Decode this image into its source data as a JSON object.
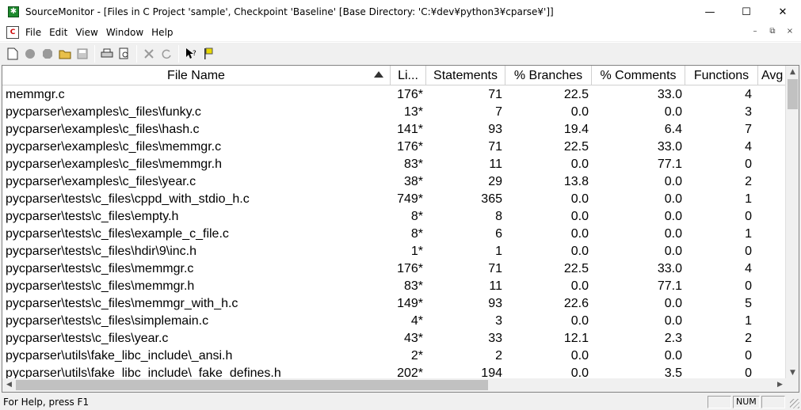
{
  "window": {
    "title": "SourceMonitor - [Files in C Project 'sample', Checkpoint 'Baseline'  [Base Directory: 'C:¥dev¥python3¥cparse¥']]",
    "minimize": "—",
    "maximize": "☐",
    "close": "✕"
  },
  "menu": {
    "items": [
      "File",
      "Edit",
      "View",
      "Window",
      "Help"
    ],
    "mdi": [
      "–",
      "⧉",
      "×"
    ]
  },
  "toolbar": {
    "icons": [
      "new-file-icon",
      "record-icon",
      "stop-icon",
      "open-folder-icon",
      "save-icon",
      "print-icon",
      "print-preview-icon",
      "delete-icon",
      "refresh-icon",
      "help-cursor-icon",
      "flag-icon"
    ]
  },
  "table": {
    "headers": [
      "File Name",
      "Li...",
      "Statements",
      "% Branches",
      "% Comments",
      "Functions",
      "Avg"
    ],
    "rows": [
      [
        "memmgr.c",
        "176*",
        "71",
        "22.5",
        "33.0",
        "4"
      ],
      [
        "pycparser\\examples\\c_files\\funky.c",
        "13*",
        "7",
        "0.0",
        "0.0",
        "3"
      ],
      [
        "pycparser\\examples\\c_files\\hash.c",
        "141*",
        "93",
        "19.4",
        "6.4",
        "7"
      ],
      [
        "pycparser\\examples\\c_files\\memmgr.c",
        "176*",
        "71",
        "22.5",
        "33.0",
        "4"
      ],
      [
        "pycparser\\examples\\c_files\\memmgr.h",
        "83*",
        "11",
        "0.0",
        "77.1",
        "0"
      ],
      [
        "pycparser\\examples\\c_files\\year.c",
        "38*",
        "29",
        "13.8",
        "0.0",
        "2"
      ],
      [
        "pycparser\\tests\\c_files\\cppd_with_stdio_h.c",
        "749*",
        "365",
        "0.0",
        "0.0",
        "1"
      ],
      [
        "pycparser\\tests\\c_files\\empty.h",
        "8*",
        "8",
        "0.0",
        "0.0",
        "0"
      ],
      [
        "pycparser\\tests\\c_files\\example_c_file.c",
        "8*",
        "6",
        "0.0",
        "0.0",
        "1"
      ],
      [
        "pycparser\\tests\\c_files\\hdir\\9\\inc.h",
        "1*",
        "1",
        "0.0",
        "0.0",
        "0"
      ],
      [
        "pycparser\\tests\\c_files\\memmgr.c",
        "176*",
        "71",
        "22.5",
        "33.0",
        "4"
      ],
      [
        "pycparser\\tests\\c_files\\memmgr.h",
        "83*",
        "11",
        "0.0",
        "77.1",
        "0"
      ],
      [
        "pycparser\\tests\\c_files\\memmgr_with_h.c",
        "149*",
        "93",
        "22.6",
        "0.0",
        "5"
      ],
      [
        "pycparser\\tests\\c_files\\simplemain.c",
        "4*",
        "3",
        "0.0",
        "0.0",
        "1"
      ],
      [
        "pycparser\\tests\\c_files\\year.c",
        "43*",
        "33",
        "12.1",
        "2.3",
        "2"
      ],
      [
        "pycparser\\utils\\fake_libc_include\\_ansi.h",
        "2*",
        "2",
        "0.0",
        "0.0",
        "0"
      ],
      [
        "pycparser\\utils\\fake_libc_include\\_fake_defines.h",
        "202*",
        "194",
        "0.0",
        "3.5",
        "0"
      ]
    ]
  },
  "status": {
    "help_text": "For Help, press F1",
    "num_indicator": "NUM"
  }
}
